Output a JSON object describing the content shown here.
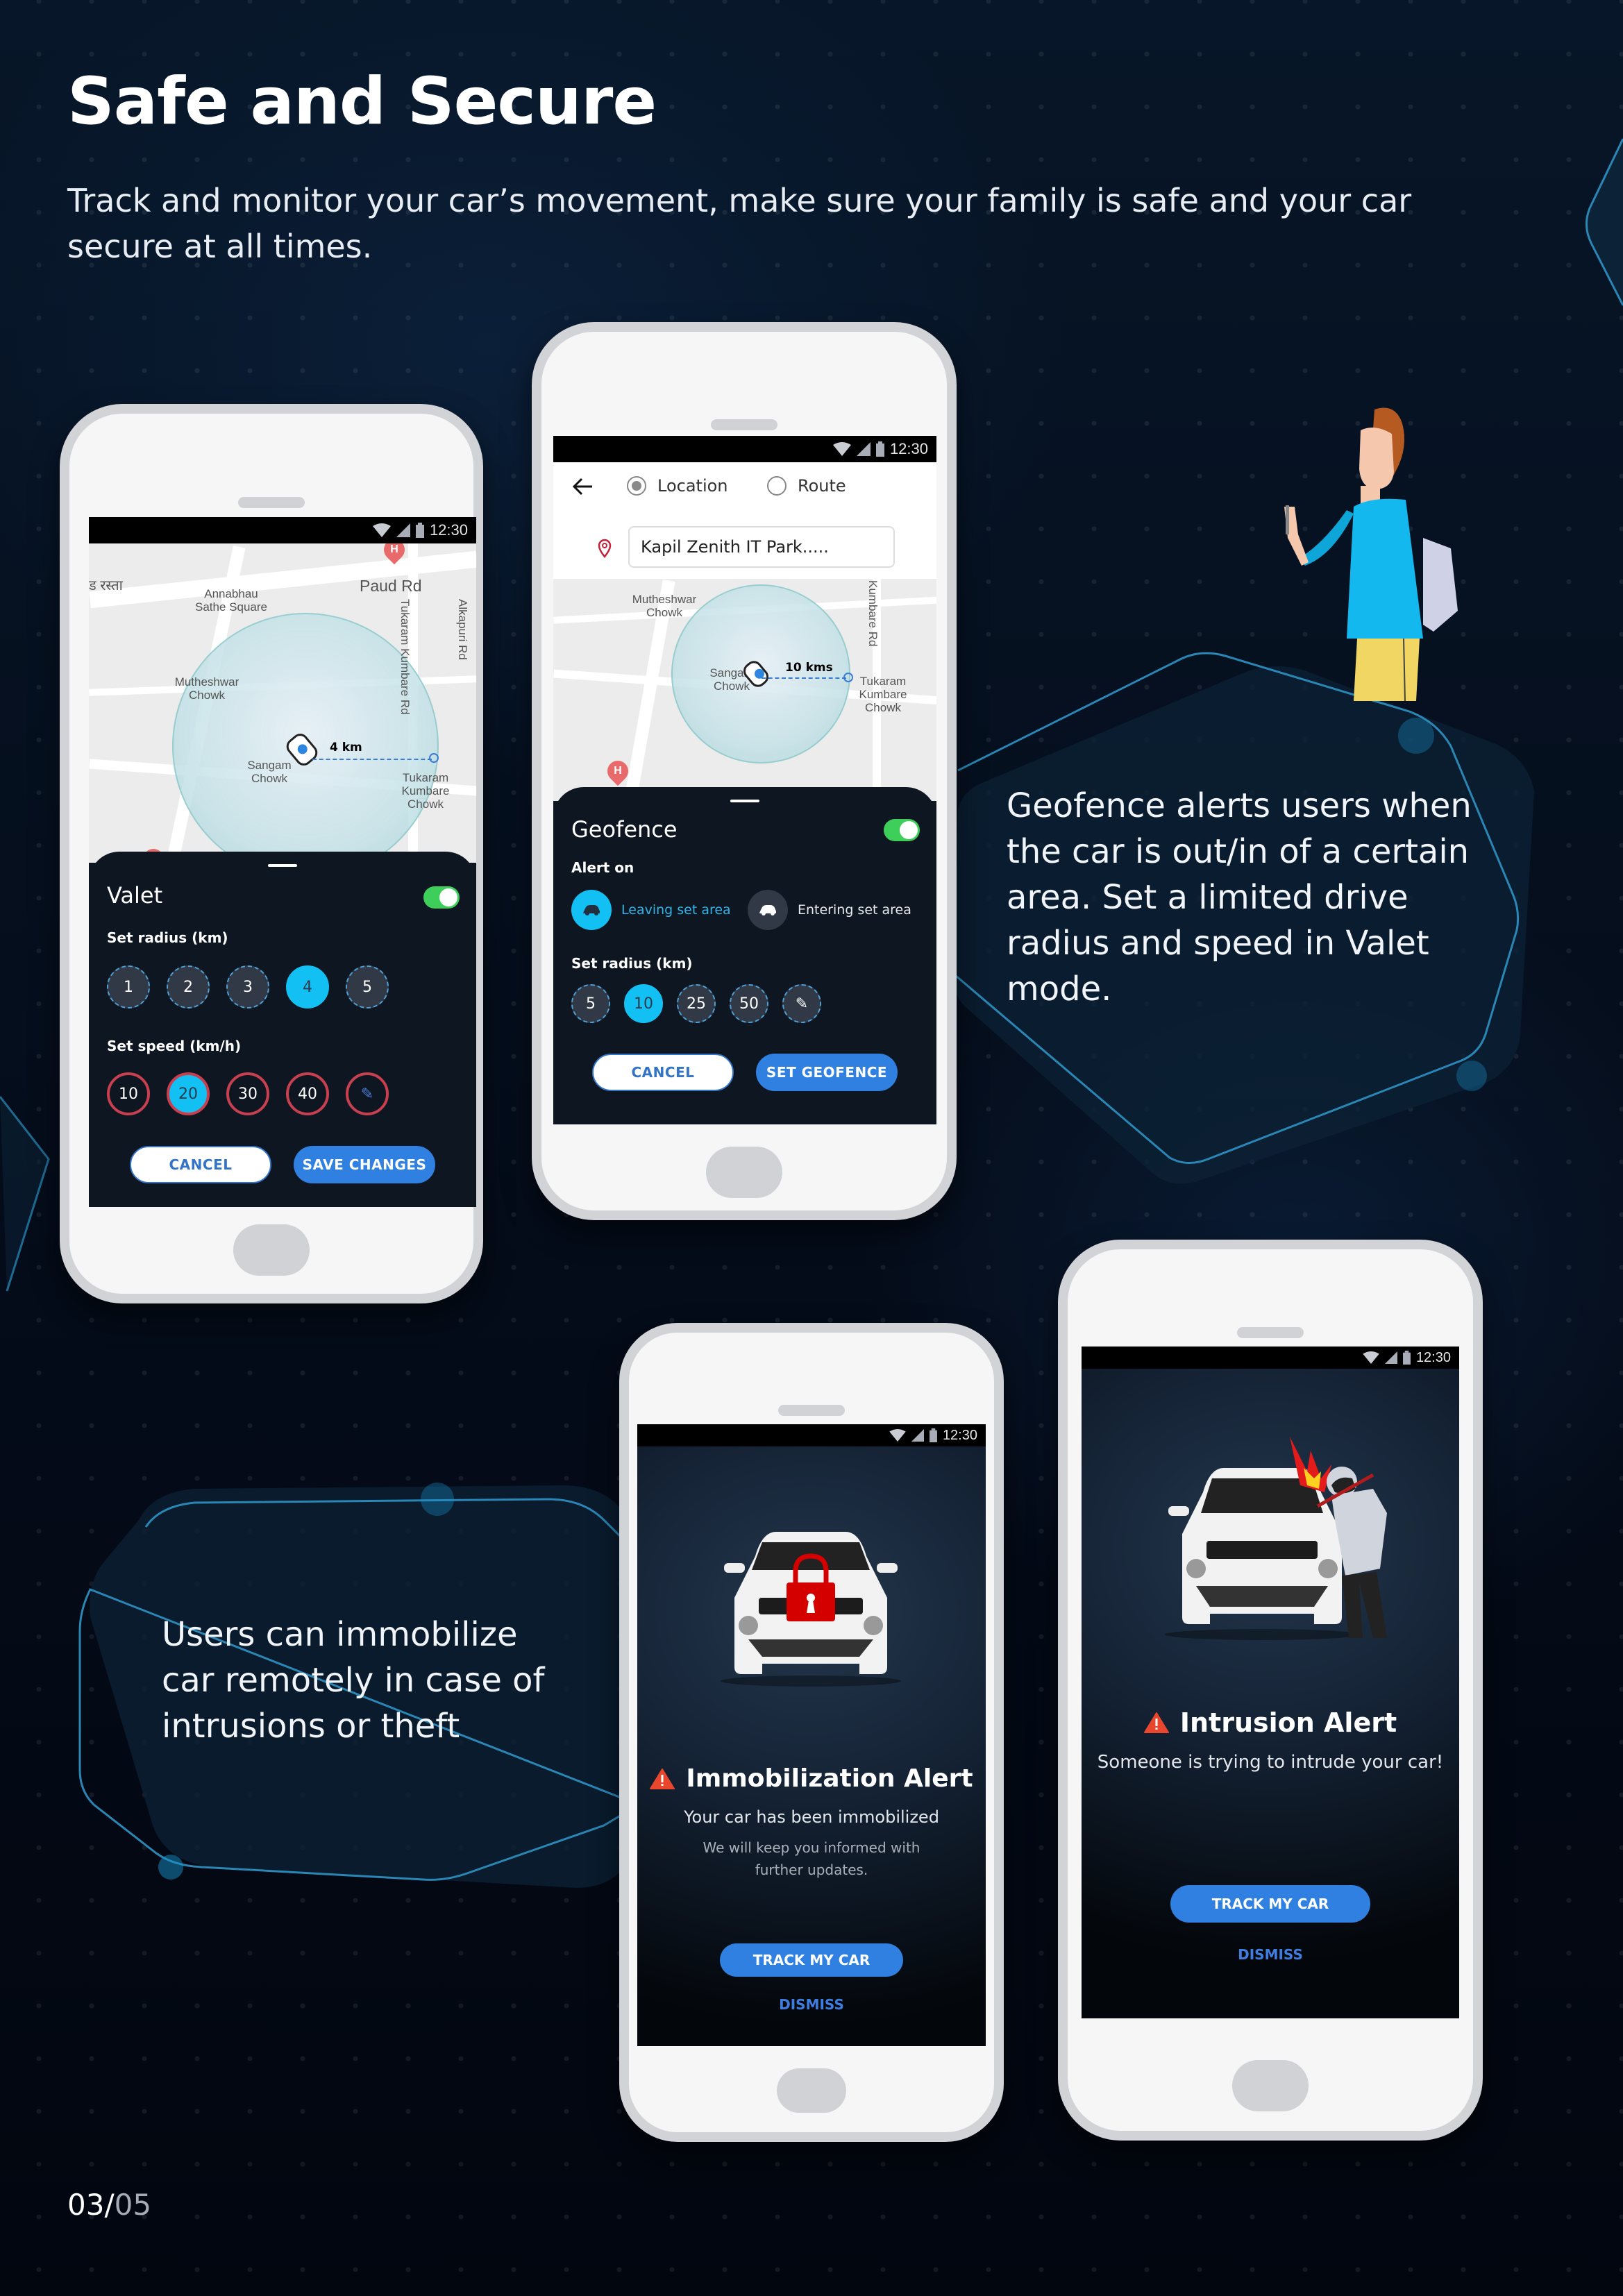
{
  "header": {
    "title": "Safe and Secure",
    "subtitle": "Track and monitor your car’s movement, make sure your family is safe and your car secure at all times."
  },
  "captions": {
    "geofence": "Geofence alerts users when the car is out/in of a certain area. Set a limited drive radius and speed in Valet mode.",
    "immobilize": "Users can immobilize car remotely in case of intrusions or theft"
  },
  "pagination": {
    "current": "03",
    "separator": "/",
    "total": "05"
  },
  "status_bar": {
    "time": "12:30"
  },
  "colors": {
    "accent_cyan": "#12c0f3",
    "primary_blue": "#2f80e0",
    "toggle_green": "#3ecf5a",
    "speed_ring_red": "#c8404f",
    "alert_red": "#e8472d"
  },
  "valet_screen": {
    "map": {
      "labels": [
        "ड रस्ता",
        "Annabhau Sathe Square",
        "Paud Rd",
        "Tukaram Kumbare Rd",
        "Alkapuri Rd",
        "Mutheshwar Chowk",
        "Sangam Chowk",
        "Tukaram Kumbare Chowk"
      ],
      "distance_label": "4 km"
    },
    "sheet": {
      "title": "Valet",
      "toggle_on": true,
      "radius_label": "Set radius (km)",
      "radius_options": [
        "1",
        "2",
        "3",
        "4",
        "5"
      ],
      "radius_selected": "4",
      "speed_label": "Set speed (km/h)",
      "speed_options": [
        "10",
        "20",
        "30",
        "40"
      ],
      "speed_selected": "20",
      "cancel_label": "CANCEL",
      "save_label": "SAVE CHANGES"
    }
  },
  "geofence_screen": {
    "modes": [
      {
        "label": "Location",
        "selected": true
      },
      {
        "label": "Route",
        "selected": false
      }
    ],
    "location_value": "Kapil Zenith IT Park.....",
    "map": {
      "labels": [
        "Mutheshwar Chowk",
        "Sangam Chowk",
        "Kumbare Rd",
        "Tukaram Kumbare Chowk"
      ],
      "distance_label": "10 kms"
    },
    "sheet": {
      "title": "Geofence",
      "toggle_on": true,
      "alert_label": "Alert on",
      "alert_options": [
        {
          "label": "Leaving set area",
          "selected": true
        },
        {
          "label": "Entering set area",
          "selected": false
        }
      ],
      "radius_label": "Set radius (km)",
      "radius_options": [
        "5",
        "10",
        "25",
        "50"
      ],
      "radius_selected": "10",
      "cancel_label": "CANCEL",
      "confirm_label": "SET GEOFENCE"
    }
  },
  "immobilization_screen": {
    "title": "Immobilization Alert",
    "message": "Your car has been immobilized",
    "detail": "We will keep you informed with further updates.",
    "track_label": "TRACK MY CAR",
    "dismiss_label": "DISMISS"
  },
  "intrusion_screen": {
    "title": "Intrusion Alert",
    "message": "Someone is trying to intrude your car!",
    "track_label": "TRACK MY CAR",
    "dismiss_label": "DISMISS"
  }
}
